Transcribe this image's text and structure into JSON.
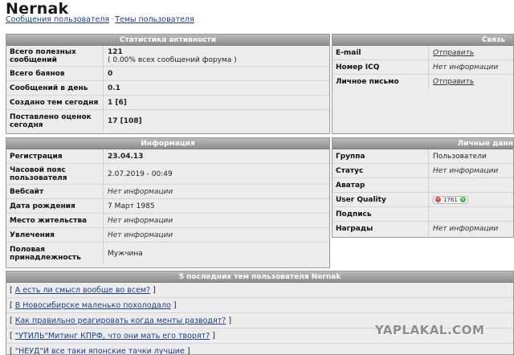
{
  "profile": {
    "username": "Nernak",
    "links": [
      "Сообщения пользователя",
      "Темы пользователя"
    ],
    "separator": "·"
  },
  "stats": {
    "title": "Статистика активности",
    "rows": [
      {
        "label": "Всего полезных сообщений",
        "value": "121",
        "sub": "( 0.00% всех сообщений форума )"
      },
      {
        "label": "Всего баянов",
        "value": "0"
      },
      {
        "label": "Сообщений в день",
        "value": "0.1"
      },
      {
        "label": "Создано тем сегодня",
        "value": "1 [6]"
      },
      {
        "label": "Поставлено оценок сегодня",
        "value": "17 [108]"
      }
    ]
  },
  "contact": {
    "title": "Связь",
    "rows": [
      {
        "label": "E-mail",
        "value": "Отправить"
      },
      {
        "label": "Номер ICQ",
        "value": "Нет информации"
      },
      {
        "label": "Личное письмо",
        "value": "Отправить"
      }
    ]
  },
  "info": {
    "title": "Информация",
    "rows": [
      {
        "label": "Регистрация",
        "value": "23.04.13"
      },
      {
        "label": "Часовой пояс пользователя",
        "value": "2.07.2019 - 00:49"
      },
      {
        "label": "Вебсайт",
        "value": "Нет информации"
      },
      {
        "label": "Дата рождения",
        "value": "7 Март 1985"
      },
      {
        "label": "Место жительства",
        "value": "Нет информации"
      },
      {
        "label": "Увлечения",
        "value": "Нет информации"
      },
      {
        "label": "Половая принадлежность",
        "value": "Мужчина"
      }
    ]
  },
  "personal": {
    "title": "Личные данн",
    "rows": [
      {
        "label": "Группа",
        "value": "Пользователи"
      },
      {
        "label": "Статус",
        "value": "Нет информации"
      },
      {
        "label": "Аватар",
        "value": ""
      },
      {
        "label": "User Quality",
        "value": "1761"
      },
      {
        "label": "Подпись",
        "value": ""
      },
      {
        "label": "Награды",
        "value": "Нет информации"
      }
    ],
    "uq_minus": "−",
    "uq_plus": "+"
  },
  "topics": {
    "title": "5 последних тем пользователя Nernak",
    "items": [
      "А есть ли смысл вообще во всем?",
      "В Новосибирске маленько похолодало",
      "Как правильно реагировать когда менты разводят?",
      "\"УТИЛЬ\"Митинг КПРФ, что они мать его творят?",
      "\"НЕУД\"И все таки японские тачки лучшие"
    ]
  },
  "watermark": "YAPLAKAL.COM"
}
